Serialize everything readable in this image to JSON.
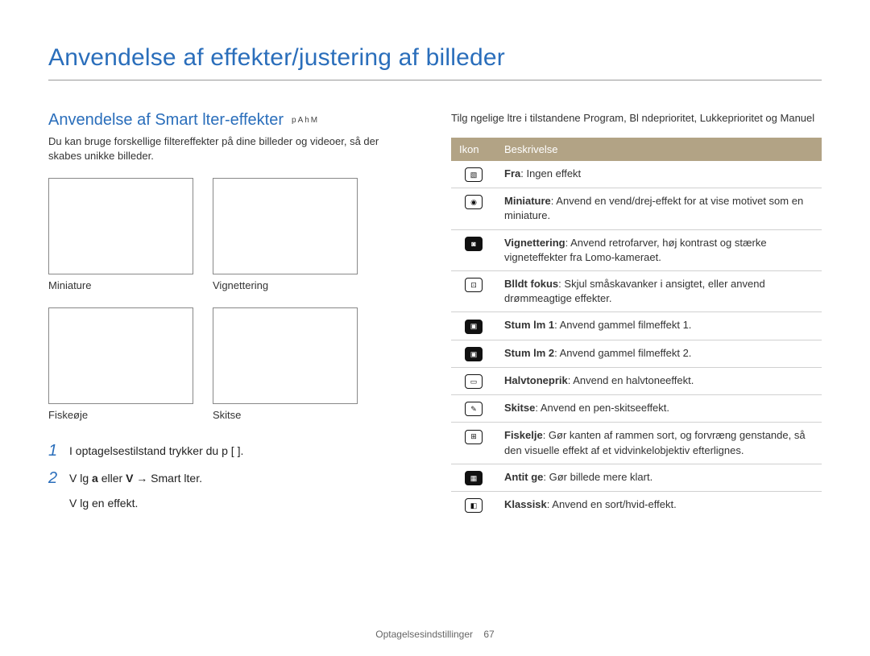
{
  "page": {
    "title": "Anvendelse af effekter/justering af billeder",
    "footer_section": "Optagelsesindstillinger",
    "footer_page": "67"
  },
  "left": {
    "section_title": "Anvendelse af Smart lter-effekter",
    "mode_icons": [
      "p",
      "A",
      "h",
      "M"
    ],
    "intro": "Du kan bruge forskellige filtereffekter på dine billeder og videoer, så der skabes unikke billeder.",
    "thumbs": [
      {
        "label": "Miniature"
      },
      {
        "label": "Vignettering"
      },
      {
        "label": "Fiskeøje"
      },
      {
        "label": "Skitse"
      }
    ],
    "steps": {
      "s1_num": "1",
      "s1_text_a": "I optagelsestilstand trykker du p  [",
      "s1_text_b": "].",
      "s2_num": "2",
      "s2_text_a": "V lg ",
      "s2_bold_a": "a",
      "s2_text_b": "   eller ",
      "s2_bold_b": "V",
      "s2_text_c": "   → Smart lter.",
      "s2_sub": "V lg en effekt."
    }
  },
  "right": {
    "intro": "Tilg ngelige  ltre i tilstandene Program, Bl ndeprioritet, Lukkeprioritet og Manuel",
    "headers": {
      "icon": "Ikon",
      "desc": "Beskrivelse"
    },
    "rows": [
      {
        "icon_glyph": "▧",
        "name": "Fra",
        "rest": ": Ingen effekt"
      },
      {
        "icon_glyph": "◉",
        "name": "Miniature",
        "rest": ": Anvend en vend/drej-effekt for at vise motivet som en miniature."
      },
      {
        "icon_glyph": "◙",
        "name": "Vignettering",
        "rest": ": Anvend retrofarver, høj kontrast og stærke vigneteffekter fra Lomo-kameraet."
      },
      {
        "icon_glyph": "⊡",
        "name": "Blldt fokus",
        "rest": ": Skjul småskavanker i ansigtet, eller anvend drømmeagtige effekter."
      },
      {
        "icon_glyph": "▣",
        "name": "Stum lm 1",
        "rest": ": Anvend gammel filmeffekt 1."
      },
      {
        "icon_glyph": "▣",
        "name": "Stum lm 2",
        "rest": ": Anvend gammel filmeffekt 2."
      },
      {
        "icon_glyph": "▭",
        "name": "Halvtoneprik",
        "rest": ": Anvend en halvtoneeffekt."
      },
      {
        "icon_glyph": "✎",
        "name": "Skitse",
        "rest": ": Anvend en pen-skitseeffekt."
      },
      {
        "icon_glyph": "⊞",
        "name": "Fiskelje",
        "rest": ": Gør kanten af rammen sort, og forvræng genstande, så den visuelle effekt af et vidvinkelobjektiv efterlignes."
      },
      {
        "icon_glyph": "▦",
        "name": "Antit ge",
        "rest": ": Gør billede mere klart."
      },
      {
        "icon_glyph": "◧",
        "name": "Klassisk",
        "rest": ": Anvend en sort/hvid-effekt."
      }
    ]
  }
}
